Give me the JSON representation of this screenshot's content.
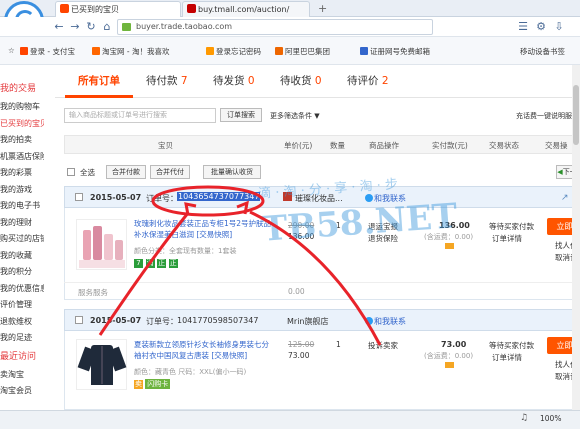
{
  "browser": {
    "tabs": [
      {
        "title": "已买到的宝贝",
        "active": true
      },
      {
        "title": "buy.tmall.com/auction/",
        "active": false
      }
    ],
    "new_tab": "+",
    "url": "buyer.trade.taobao.com",
    "bookmarks": [
      "登录 - 支付宝",
      "淘宝网 - 淘！我喜欢",
      "登录忘记密码",
      "阿里巴巴集团",
      "证册网号免费邮箱"
    ],
    "bookmark_right": "移动设备书签",
    "status_zoom": "100%"
  },
  "sidebar": {
    "sections": [
      {
        "label": "我的交易",
        "head": true
      },
      {
        "label": "我的购物车",
        "head": false
      },
      {
        "label": "已买到的宝贝",
        "head": false,
        "active": true
      },
      {
        "label": "我的拍卖",
        "head": false
      },
      {
        "label": "机票酒店保险",
        "head": false
      },
      {
        "label": "我的彩票",
        "head": false
      },
      {
        "label": "我的游戏",
        "head": false
      },
      {
        "label": "我的电子书",
        "head": false
      },
      {
        "label": "我的理财",
        "head": false
      },
      {
        "label": "购买过的店铺",
        "head": false
      },
      {
        "label": "我的收藏",
        "head": false
      },
      {
        "label": "我的积分",
        "head": false
      },
      {
        "label": "我的优惠信息",
        "head": false
      },
      {
        "label": "评价管理",
        "head": false
      },
      {
        "label": "退款维权",
        "head": false
      },
      {
        "label": "我的足迹",
        "head": false
      },
      {
        "label": "最近访问",
        "head": true
      },
      {
        "label": "卖淘宝",
        "head": false
      },
      {
        "label": "淘宝会员",
        "head": false
      }
    ]
  },
  "tabs": {
    "all": "所有订单",
    "pay": "待付款",
    "pay_n": "7",
    "ship": "待发货",
    "ship_n": "0",
    "recv": "待收货",
    "recv_n": "0",
    "rate": "待评价",
    "rate_n": "2"
  },
  "search": {
    "placeholder": "输入商品标题或订单号进行搜索",
    "button": "订单搜索",
    "more": "更多筛选条件",
    "right": "充话费一键说明服"
  },
  "table": {
    "headers": [
      "宝贝",
      "单价(元)",
      "数量",
      "商品操作",
      "实付款(元)",
      "交易状态",
      "交易操"
    ],
    "select_all": "全选",
    "merge_pay": "合并付款",
    "merge_proxy": "合并代付",
    "batch_confirm": "批量确认收货",
    "next": "下一"
  },
  "orders": [
    {
      "date": "2015-05-07",
      "order_label": "订单号：",
      "order_no": "1043654737077347",
      "shop": "璀璨化妆品...",
      "contact": "和我联系",
      "title": "玫瑰刺化妆品套装正品专柜1号2号护肤品补水保湿美白滋润 [交易快照]",
      "attr": "颜色分类：全套现有数量：1套装",
      "orig_price": "290.00",
      "price": "136.00",
      "qty": "1",
      "op1": "退运宝报",
      "op2": "退货保险",
      "paid": "136.00",
      "ship_fee": "(含运费：0.00)",
      "status1": "等待买家付款",
      "status2": "订单详情",
      "pay_btn": "立即付",
      "act1": "找人代",
      "act2": "取消订",
      "service": "服务服务",
      "service_val": "0.00",
      "badges": [
        "7",
        "消",
        "正",
        "正"
      ]
    },
    {
      "date": "2015-05-07",
      "order_label": "订单号：",
      "order_no": "1041770598507347",
      "shop": "Mrin旗舰店",
      "contact": "和我联系",
      "title": "夏装新款立领原针衫女长袖修身男装七分袖衬衣中国风复古唐装 [交易快照]",
      "attr": "颜色：藏青色  尺码：XXL(偏小一码)",
      "orig_price": "125.00",
      "price": "73.00",
      "qty": "1",
      "op1": "投诉卖家",
      "op2": "",
      "paid": "73.00",
      "ship_fee": "(含运费：0.00)",
      "status1": "等待买家付款",
      "status2": "订单详情",
      "pay_btn": "立即付",
      "act1": "找人代",
      "act2": "取消订",
      "service": "",
      "service_val": "",
      "badges": [
        "卖"
      ],
      "promo": "闪购卡"
    }
  ],
  "watermark": {
    "line1": "滴 · 淘 · 分 · 享 · 淘 · 步",
    "line2": "TB58.NET"
  },
  "colors": {
    "accent": "#ff4400",
    "annotation": "#e8232a",
    "link": "#3366cc"
  }
}
